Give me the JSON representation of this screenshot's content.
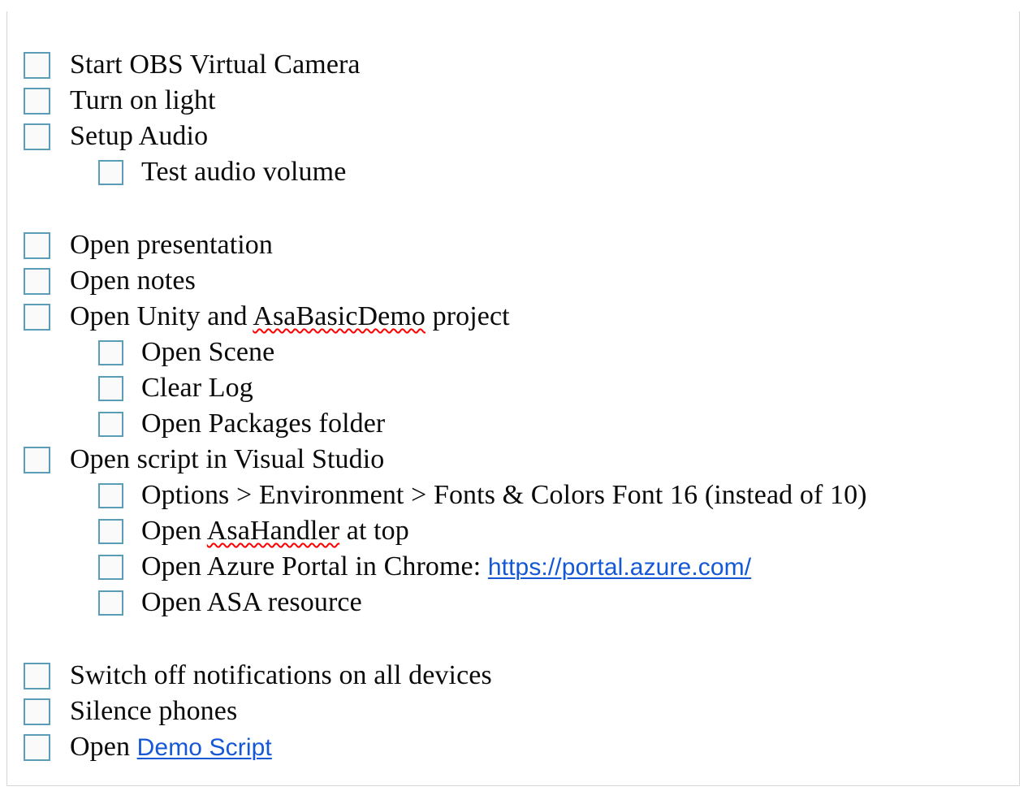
{
  "window": {
    "titlebar": {
      "grip_icon": "drag-grip-dots-icon",
      "nav_back_icon": "triangle-left-icon",
      "nav_forward_icon": "triangle-right-icon"
    },
    "checkbox_border_color": "#5b9cb8",
    "link_color": "#1558d6",
    "spellcheck_color": "#ff0000",
    "titlebar_bg": "#e2e2e2"
  },
  "checklist": {
    "items": [
      {
        "id": "start-obs-virtual-camera",
        "text": "Start OBS Virtual Camera",
        "indent": 0,
        "checked": false,
        "type": "item"
      },
      {
        "id": "turn-on-light",
        "text": "Turn on light",
        "indent": 0,
        "checked": false,
        "type": "item"
      },
      {
        "id": "setup-audio",
        "text": "Setup Audio",
        "indent": 0,
        "checked": false,
        "type": "item"
      },
      {
        "id": "test-audio-volume",
        "text": "Test audio volume",
        "indent": 1,
        "checked": false,
        "type": "item"
      },
      {
        "id": "spacer-1",
        "text": "",
        "indent": 0,
        "checked": false,
        "type": "spacer"
      },
      {
        "id": "open-presentation",
        "text": "Open presentation",
        "indent": 0,
        "checked": false,
        "type": "item"
      },
      {
        "id": "open-notes",
        "text": "Open notes",
        "indent": 0,
        "checked": false,
        "type": "item"
      },
      {
        "id": "open-unity-and-asabasicdemo-project",
        "text": "Open Unity and AsaBasicDemo project",
        "indent": 0,
        "checked": false,
        "type": "rich",
        "parts": [
          {
            "t": "Open Unity and ",
            "style": "plain"
          },
          {
            "t": "AsaBasicDemo",
            "style": "misspell"
          },
          {
            "t": " project",
            "style": "plain"
          }
        ]
      },
      {
        "id": "open-scene",
        "text": "Open Scene",
        "indent": 1,
        "checked": false,
        "type": "item"
      },
      {
        "id": "clear-log",
        "text": "Clear Log",
        "indent": 1,
        "checked": false,
        "type": "item"
      },
      {
        "id": "open-packages-folder",
        "text": "Open Packages folder",
        "indent": 1,
        "checked": false,
        "type": "item"
      },
      {
        "id": "open-script-in-visual-studio",
        "text": "Open script in Visual Studio",
        "indent": 0,
        "checked": false,
        "type": "item"
      },
      {
        "id": "options-environment-fonts-colors",
        "text": "Options > Environment > Fonts & Colors Font 16 (instead of 10)",
        "indent": 1,
        "checked": false,
        "type": "item"
      },
      {
        "id": "open-asahandler-at-top",
        "text": "Open AsaHandler at top",
        "indent": 1,
        "checked": false,
        "type": "rich",
        "parts": [
          {
            "t": "Open ",
            "style": "plain"
          },
          {
            "t": "AsaHandler",
            "style": "misspell"
          },
          {
            "t": " at top",
            "style": "plain"
          }
        ]
      },
      {
        "id": "open-azure-portal-in-chrome",
        "text": "Open Azure Portal in Chrome: https://portal.azure.com/",
        "indent": 1,
        "checked": false,
        "type": "rich",
        "parts": [
          {
            "t": "Open Azure Portal in Chrome: ",
            "style": "plain"
          },
          {
            "t": "https://portal.azure.com/",
            "style": "link"
          }
        ]
      },
      {
        "id": "open-asa-resource",
        "text": "Open ASA resource",
        "indent": 1,
        "checked": false,
        "type": "item"
      },
      {
        "id": "spacer-2",
        "text": "",
        "indent": 0,
        "checked": false,
        "type": "spacer"
      },
      {
        "id": "switch-off-notifications-on-all-devices",
        "text": "Switch off notifications on all devices",
        "indent": 0,
        "checked": false,
        "type": "item"
      },
      {
        "id": "silence-phones",
        "text": "Silence phones",
        "indent": 0,
        "checked": false,
        "type": "item"
      },
      {
        "id": "open-demo-script",
        "text": "Open Demo Script",
        "indent": 0,
        "checked": false,
        "type": "rich",
        "parts": [
          {
            "t": "Open ",
            "style": "plain"
          },
          {
            "t": "Demo Script",
            "style": "link"
          }
        ]
      }
    ]
  }
}
